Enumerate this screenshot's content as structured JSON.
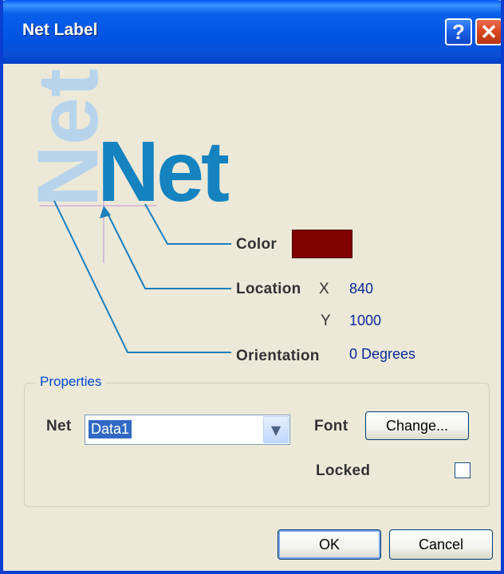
{
  "window": {
    "title": "Net Label",
    "help_glyph": "?",
    "close_glyph": "✕"
  },
  "diagram": {
    "sample_text": "Net",
    "color_label": "Color",
    "color_value": "#800000",
    "location_label": "Location",
    "x_label": "X",
    "x_value": "840",
    "y_label": "Y",
    "y_value": "1000",
    "orientation_label": "Orientation",
    "orientation_value": "0 Degrees"
  },
  "properties": {
    "group_title": "Properties",
    "net_label": "Net",
    "net_value": "Data1",
    "font_label": "Font",
    "change_button": "Change...",
    "locked_label": "Locked",
    "locked_checked": false
  },
  "buttons": {
    "ok": "OK",
    "cancel": "Cancel"
  },
  "colors": {
    "titlebar": "#0054e3",
    "dialog_bg": "#ece9d8",
    "net_text": "#1483c0",
    "net_text_rotated": "#b8d4ec",
    "leader_line": "#1a7fbd",
    "value_text": "#0a2a9a"
  }
}
